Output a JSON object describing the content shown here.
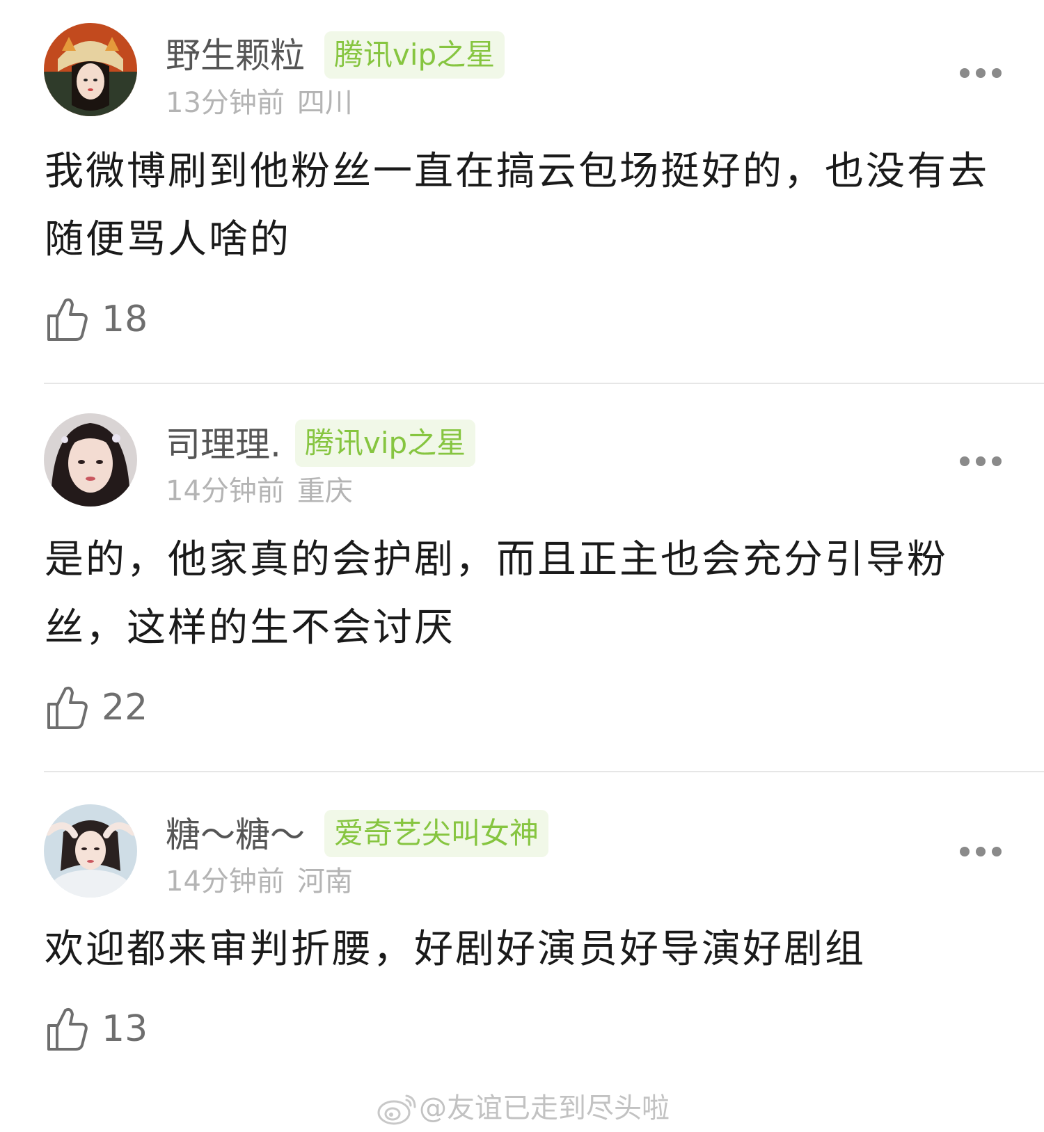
{
  "comments": [
    {
      "username": "野生颗粒",
      "badge": "腾讯vip之星",
      "time": "13分钟前",
      "location": "四川",
      "text": "我微博刷到他粉丝一直在搞云包场挺好的，也没有去随便骂人啥的",
      "likes": "18"
    },
    {
      "username": "司理理.",
      "badge": "腾讯vip之星",
      "time": "14分钟前",
      "location": "重庆",
      "text": "是的，他家真的会护剧，而且正主也会充分引导粉丝，这样的生不会讨厌",
      "likes": "22"
    },
    {
      "username": "糖～糖～",
      "badge": "爱奇艺尖叫女神",
      "time": "14分钟前",
      "location": "河南",
      "text": "欢迎都来审判折腰，好剧好演员好导演好剧组",
      "likes": "13"
    }
  ],
  "watermark": {
    "text": "@友谊已走到尽头啦",
    "icon": "weibo-logo-icon"
  },
  "icons": {
    "like": "thumbs-up-icon",
    "more": "more-dots-icon",
    "avatar": "avatar"
  },
  "colors": {
    "badge_text": "#86c540",
    "badge_bg": "#f1f8e8",
    "body_text": "#1a1a1a",
    "meta_text": "#b4b4b4",
    "divider": "#e6e6e6"
  }
}
